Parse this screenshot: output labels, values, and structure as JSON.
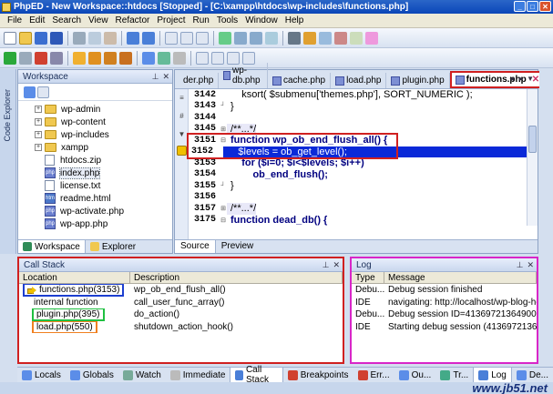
{
  "window": {
    "title": "PhpED - New Workspace::htdocs [Stopped] - [C:\\xampp\\htdocs\\wp-includes\\functions.php]"
  },
  "menu": {
    "items": [
      "File",
      "Edit",
      "Search",
      "View",
      "Refactor",
      "Project",
      "Run",
      "Tools",
      "Window",
      "Help"
    ]
  },
  "left_strip": {
    "label": "Code Explorer"
  },
  "workspace": {
    "title": "Workspace",
    "tree": [
      {
        "label": "wp-admin",
        "type": "folder",
        "expandable": true
      },
      {
        "label": "wp-content",
        "type": "folder",
        "expandable": true
      },
      {
        "label": "wp-includes",
        "type": "folder",
        "expandable": true
      },
      {
        "label": "xampp",
        "type": "folder",
        "expandable": true
      },
      {
        "label": "htdocs.zip",
        "type": "file",
        "expandable": false
      },
      {
        "label": "index.php",
        "type": "php",
        "expandable": false,
        "selected": true
      },
      {
        "label": "license.txt",
        "type": "file",
        "expandable": false
      },
      {
        "label": "readme.html",
        "type": "file",
        "expandable": false
      },
      {
        "label": "wp-activate.php",
        "type": "php",
        "expandable": false
      },
      {
        "label": "wp-app.php",
        "type": "php",
        "expandable": false
      }
    ],
    "tabs": [
      "Workspace",
      "Explorer"
    ]
  },
  "editor": {
    "tabs": [
      "der.php",
      "wp-db.php",
      "cache.php",
      "load.php",
      "plugin.php",
      "functions.php"
    ],
    "active_tab": "functions.php",
    "lines": [
      {
        "n": "3142",
        "code": "    ksort( $submenu['themes.php'], SORT_NUMERIC );"
      },
      {
        "n": "3143",
        "code": "}"
      },
      {
        "n": "3144",
        "code": ""
      },
      {
        "n": "3145",
        "code": "/**...*/"
      },
      {
        "n": "3151",
        "code": "function wp_ob_end_flush_all() {"
      },
      {
        "n": "3152",
        "code": "    $levels = ob_get_level();"
      },
      {
        "n": "3153",
        "code": "    for ($i=0; $i<$levels; $i++)"
      },
      {
        "n": "3154",
        "code": "        ob_end_flush();"
      },
      {
        "n": "3155",
        "code": "}"
      },
      {
        "n": "3156",
        "code": ""
      },
      {
        "n": "3157",
        "code": "/**...*/"
      },
      {
        "n": "3175",
        "code": "function dead_db() {"
      }
    ],
    "bottom_tabs": [
      "Source",
      "Preview"
    ]
  },
  "call_stack": {
    "title": "Call Stack",
    "columns": [
      "Location",
      "Description"
    ],
    "rows": [
      {
        "location": "functions.php(3153)",
        "description": "wp_ob_end_flush_all()"
      },
      {
        "location": "internal function",
        "description": "call_user_func_array()"
      },
      {
        "location": "plugin.php(395)",
        "description": "do_action()"
      },
      {
        "location": "load.php(550)",
        "description": "shutdown_action_hook()"
      }
    ]
  },
  "log": {
    "title": "Log",
    "columns": [
      "Type",
      "Message"
    ],
    "rows": [
      {
        "type": "Debu...",
        "message": "Debug session finished"
      },
      {
        "type": "IDE",
        "message": "navigating: http://localhost/wp-blog-header"
      },
      {
        "type": "Debu...",
        "message": "Debug session ID=41369721364900002 sta"
      },
      {
        "type": "IDE",
        "message": "Starting debug session (4136972136490"
      }
    ]
  },
  "bottom_tabs": {
    "items": [
      "Locals",
      "Globals",
      "Watch",
      "Immediate",
      "Call Stack",
      "Breakpoints",
      "Err...",
      "Ou...",
      "Tr...",
      "Log",
      "De..."
    ],
    "active": "Call Stack"
  },
  "watermark": "www.jb51.net",
  "colors": {
    "highlight_line": "#0a29d8",
    "annotation_red": "#d02020",
    "annotation_blue": "#1d3fd0",
    "annotation_green": "#1fc041",
    "annotation_orange": "#f08020",
    "annotation_magenta": "#d826c8"
  }
}
